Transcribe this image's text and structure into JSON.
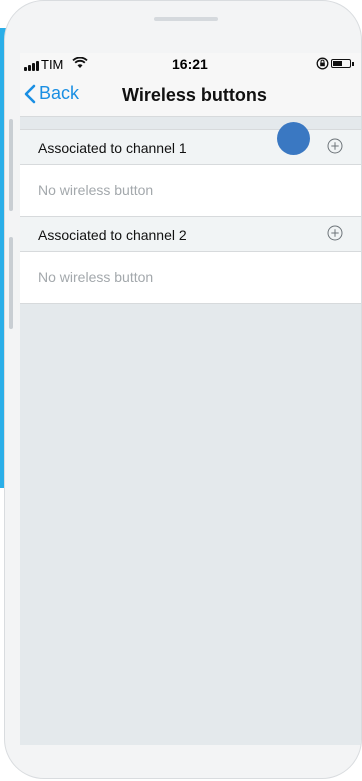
{
  "status_bar": {
    "carrier": "TIM",
    "time": "16:21",
    "icons": [
      "signal-icon",
      "wifi-icon",
      "rotation-lock-icon",
      "battery-icon"
    ]
  },
  "nav": {
    "back_label": "Back",
    "title": "Wireless buttons"
  },
  "sections": [
    {
      "header": "Associated to channel 1",
      "empty_text": "No wireless button"
    },
    {
      "header": "Associated to channel 2",
      "empty_text": "No wireless button"
    }
  ],
  "colors": {
    "accent": "#1a8fe3",
    "touch_indicator": "#3a78c2",
    "side_strip": "#2aaee8"
  }
}
